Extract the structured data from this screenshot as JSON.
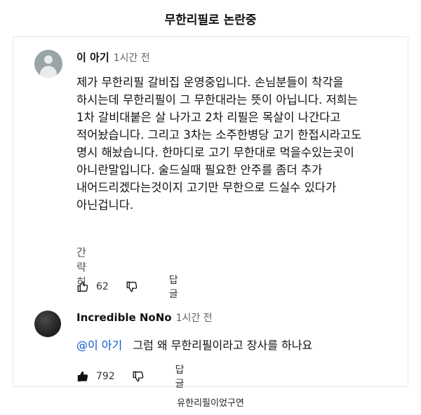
{
  "post_title": "무한리필로 논란중",
  "caption": "유한리필이었구연",
  "comments": [
    {
      "author": "이 아기",
      "time": "1시간 전",
      "body": "제가 무한리필 갈비집 운영중입니다. 손님분들이 착각을 하시는데 무한리필이 그 무한대라는 뜻이 아닙니다. 저희는 1차 갈비대붙은 살 나가고 2차 리필은 목살이 나간다고 적어놨습니다. 그리고 3차는 소주한병당 고기 한접시라고도 명시 해놨습니다. 한마디로 고기 무한대로 먹을수있는곳이 아니란말입니다. 술드실때 필요한 안주를 좀더 추가 내어드리겠다는것이지 고기만 무한으로 드실수 있다가 아닌겁니다.",
      "read_less": "간략히",
      "like_count": "62",
      "reply_label": "답글",
      "like_icon": "thumbs-up-outline-icon",
      "dislike_icon": "thumbs-down-outline-icon"
    },
    {
      "author": "Incredible NoNo",
      "time": "1시간 전",
      "mention": "@이 아기",
      "body": "그럼 왜 무한리필이라고 장사를 하나요",
      "like_count": "792",
      "reply_label": "답글",
      "like_icon": "thumbs-up-filled-icon",
      "dislike_icon": "thumbs-down-outline-icon"
    }
  ]
}
